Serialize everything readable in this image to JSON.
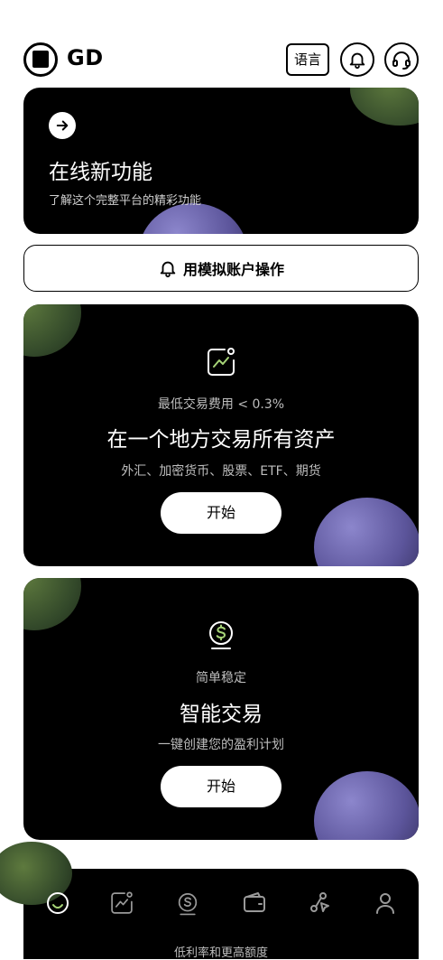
{
  "header": {
    "brand": "GD",
    "language_label": "语言"
  },
  "promo": {
    "title": "在线新功能",
    "subtitle": "了解这个完整平台的精彩功能"
  },
  "demo": {
    "label": "用模拟账户操作"
  },
  "feature_trade": {
    "caption": "最低交易费用 < 0.3%",
    "title": "在一个地方交易所有资产",
    "subtitle": "外汇、加密货币、股票、ETF、期货",
    "button": "开始"
  },
  "feature_smart": {
    "caption": "简单稳定",
    "title": "智能交易",
    "subtitle": "一键创建您的盈利计划",
    "button": "开始"
  },
  "bottom": {
    "caption": "低利率和更高额度",
    "items": [
      "home-icon",
      "chart-icon",
      "coin-icon",
      "wallet-icon",
      "network-icon",
      "user-icon"
    ]
  },
  "colors": {
    "accent_green": "#a6d477",
    "card_bg": "#000000"
  }
}
